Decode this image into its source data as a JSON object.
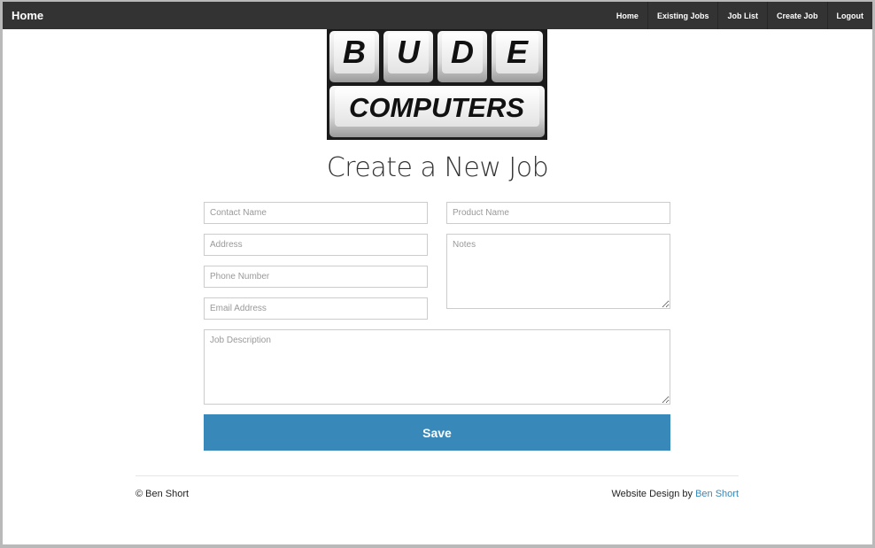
{
  "navbar": {
    "brand": "Home",
    "links": [
      "Home",
      "Existing Jobs",
      "Job List",
      "Create Job",
      "Logout"
    ]
  },
  "logo": {
    "letters": [
      "B",
      "U",
      "D",
      "E"
    ],
    "subtitle": "COMPUTERS"
  },
  "page": {
    "title": "Create a New Job"
  },
  "form": {
    "contact_name": {
      "placeholder": "Contact Name",
      "value": ""
    },
    "product_name": {
      "placeholder": "Product Name",
      "value": ""
    },
    "address": {
      "placeholder": "Address",
      "value": ""
    },
    "notes": {
      "placeholder": "Notes",
      "value": ""
    },
    "phone_number": {
      "placeholder": "Phone Number",
      "value": ""
    },
    "email_address": {
      "placeholder": "Email Address",
      "value": ""
    },
    "job_description": {
      "placeholder": "Job Description",
      "value": ""
    },
    "save_label": "Save"
  },
  "footer": {
    "copyright": "© Ben Short",
    "credit_prefix": "Website Design by ",
    "credit_link": "Ben Short"
  },
  "colors": {
    "navbar_bg": "#333333",
    "accent": "#3889b9"
  }
}
